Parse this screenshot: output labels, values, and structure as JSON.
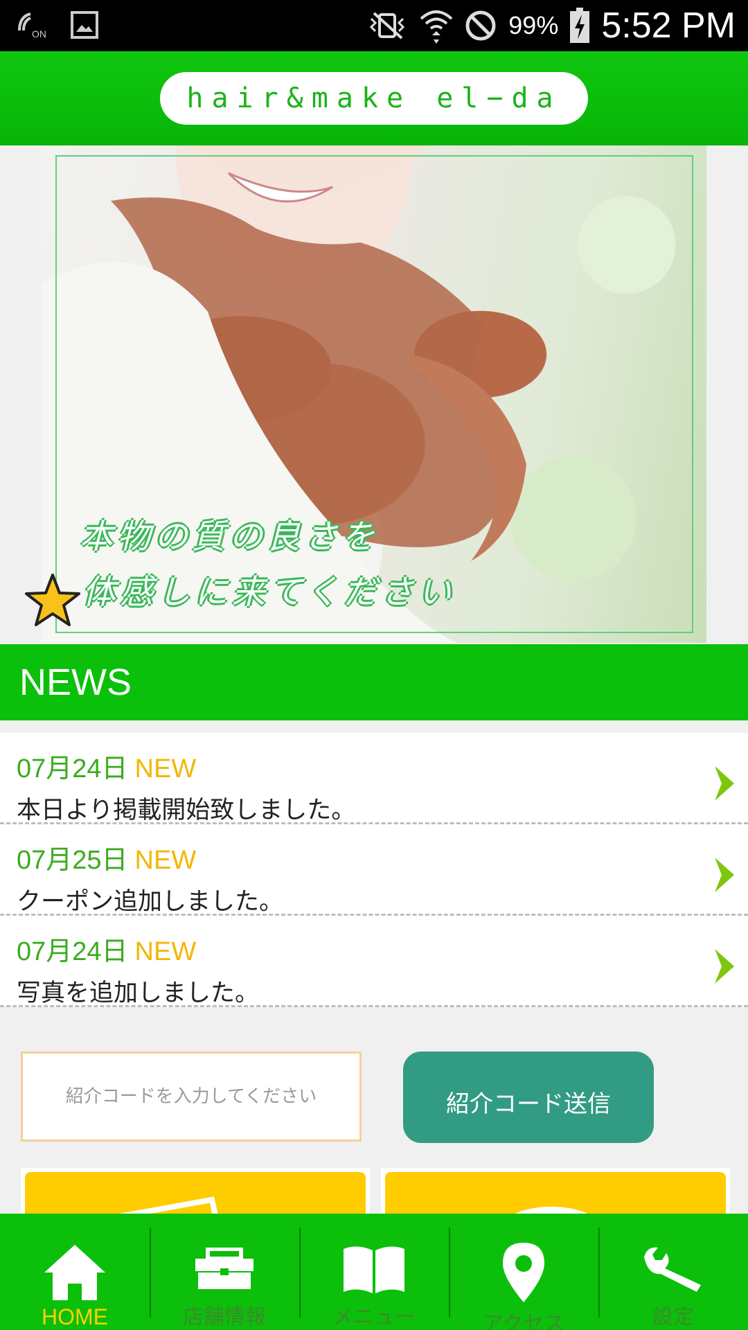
{
  "status_bar": {
    "battery": "99%",
    "time": "5:52 PM",
    "icons": [
      "nfc-icon",
      "image-icon",
      "vibrate-off-icon",
      "wifi-icon",
      "do-not-disturb-icon",
      "battery-charging-icon"
    ]
  },
  "header": {
    "logo_text": "hair&make el−da"
  },
  "hero": {
    "caption_line1": "本物の質の良さを",
    "caption_line2": "体感しに来てください"
  },
  "news": {
    "heading": "NEWS",
    "items": [
      {
        "date": "07月24日",
        "badge": "NEW",
        "title": "本日より掲載開始致しました。"
      },
      {
        "date": "07月25日",
        "badge": "NEW",
        "title": "クーポン追加しました。"
      },
      {
        "date": "07月24日",
        "badge": "NEW",
        "title": "写真を追加しました。"
      }
    ]
  },
  "referral": {
    "placeholder": "紹介コードを入力してください",
    "value": "",
    "button_label": "紹介コード送信"
  },
  "bottom_nav": {
    "items": [
      {
        "label": "HOME",
        "icon": "home-icon",
        "active": true
      },
      {
        "label": "店舗情報",
        "icon": "shop-icon",
        "active": false
      },
      {
        "label": "メニュー",
        "icon": "book-icon",
        "active": false
      },
      {
        "label": "アクセス",
        "icon": "location-pin-icon",
        "active": false
      },
      {
        "label": "設定",
        "icon": "wrench-icon",
        "active": false
      }
    ]
  },
  "colors": {
    "brand_green": "#0ac00a",
    "badge_yellow": "#f2b700",
    "date_green": "#3aab1e",
    "button_teal": "#329b83"
  }
}
